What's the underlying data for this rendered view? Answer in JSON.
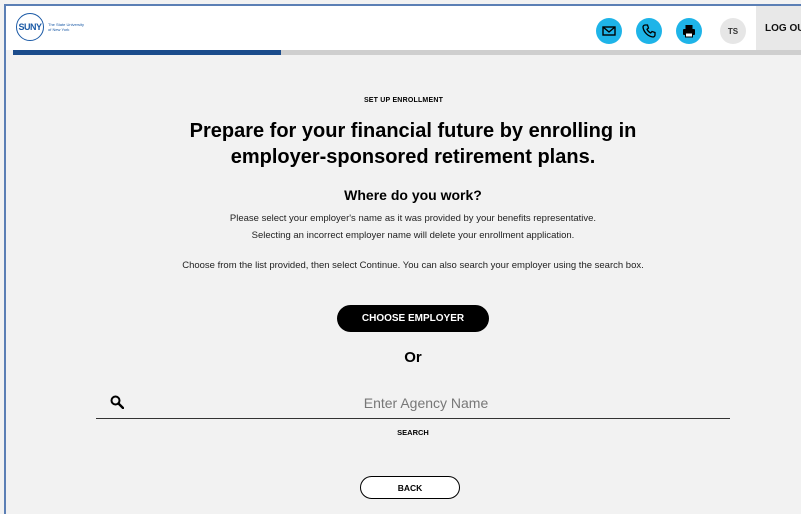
{
  "header": {
    "logo_text": "SUNY",
    "logo_subtext": "The State University of New York",
    "avatar_initials": "TS",
    "logout_label": "LOG OUT"
  },
  "progress": {
    "fraction": 0.34
  },
  "main": {
    "eyebrow": "SET UP ENROLLMENT",
    "headline_line1": "Prepare for your financial future by enrolling in",
    "headline_line2": "employer-sponsored retirement plans.",
    "subhead": "Where do you work?",
    "instruction_line1": "Please select your employer's name as it was provided by your benefits representative.",
    "instruction_line2": "Selecting an incorrect employer name will delete your enrollment application.",
    "instruction_line3": "Choose from the list provided, then select Continue. You can also search your employer using the search box.",
    "choose_button": "CHOOSE EMPLOYER",
    "or_text": "Or",
    "search_placeholder": "Enter Agency Name",
    "search_label": "SEARCH",
    "back_button": "BACK"
  },
  "colors": {
    "accent": "#1eb4e8",
    "brand": "#1b4c8c",
    "background": "#f2f2f2"
  },
  "icons": [
    "mail-icon",
    "phone-icon",
    "print-icon",
    "search-icon"
  ]
}
